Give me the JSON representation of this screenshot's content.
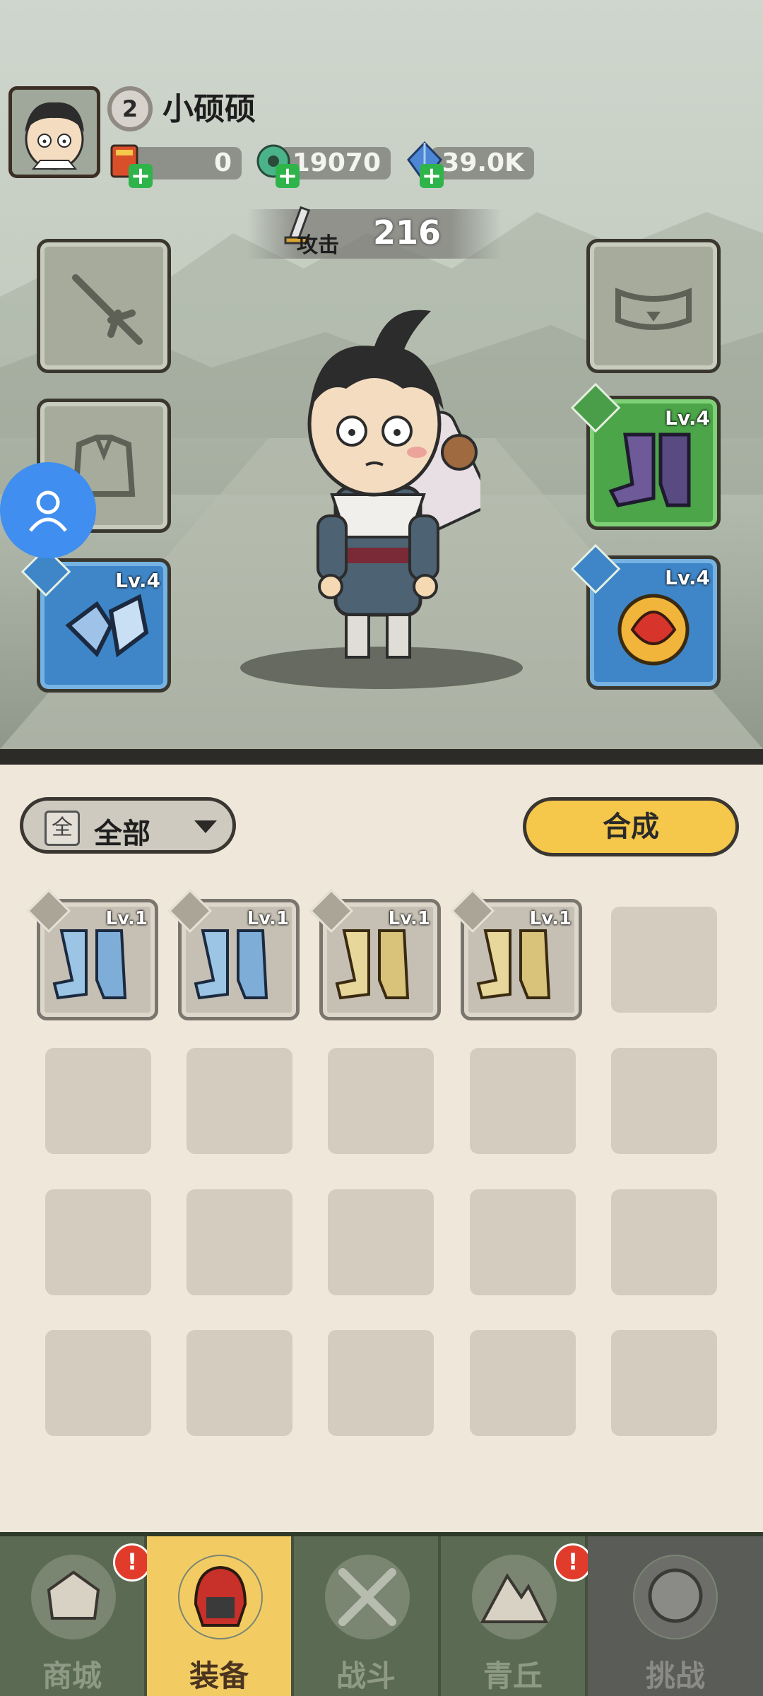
{
  "player": {
    "level": "2",
    "name": "小硕硕"
  },
  "resources": [
    {
      "name": "coupon",
      "icon": "ticket-icon",
      "value": "0"
    },
    {
      "name": "jade",
      "icon": "jade-dragon-icon",
      "value": "19070"
    },
    {
      "name": "crystal",
      "icon": "crystal-icon",
      "value": "39.0K"
    }
  ],
  "attack": {
    "label": "攻击",
    "value": "216"
  },
  "equipment_slots": {
    "weapon": {
      "icon": "sword-icon",
      "level": ""
    },
    "armor": {
      "icon": "robe-icon",
      "level": ""
    },
    "bracer": {
      "icon": "bracer-icon",
      "level": "Lv.4"
    },
    "belt": {
      "icon": "belt-icon",
      "level": ""
    },
    "boots": {
      "icon": "boots-icon",
      "level": "Lv.4"
    },
    "accessory": {
      "icon": "amulet-icon",
      "level": "Lv.4"
    }
  },
  "inventory": {
    "filter_icon_text": "全",
    "filter_label": "全部",
    "merge_label": "合成",
    "items": [
      {
        "icon": "ice-boots-icon",
        "level": "Lv.1"
      },
      {
        "icon": "ice-boots-icon",
        "level": "Lv.1"
      },
      {
        "icon": "golden-boots-icon",
        "level": "Lv.1"
      },
      {
        "icon": "golden-boots-icon",
        "level": "Lv.1"
      }
    ]
  },
  "nav": [
    {
      "label": "商城",
      "icon": "shop-icon",
      "alert": "!"
    },
    {
      "label": "装备",
      "icon": "helmet-icon",
      "alert": ""
    },
    {
      "label": "战斗",
      "icon": "crossed-swords-icon",
      "alert": ""
    },
    {
      "label": "青丘",
      "icon": "mountain-icon",
      "alert": "!"
    },
    {
      "label": "挑战",
      "icon": "challenge-icon",
      "alert": ""
    }
  ],
  "colors": {
    "accent": "#f5c74a",
    "slot_blue": "#3f86c8",
    "slot_green": "#4ca548",
    "nav_bg": "#5b6b53"
  }
}
